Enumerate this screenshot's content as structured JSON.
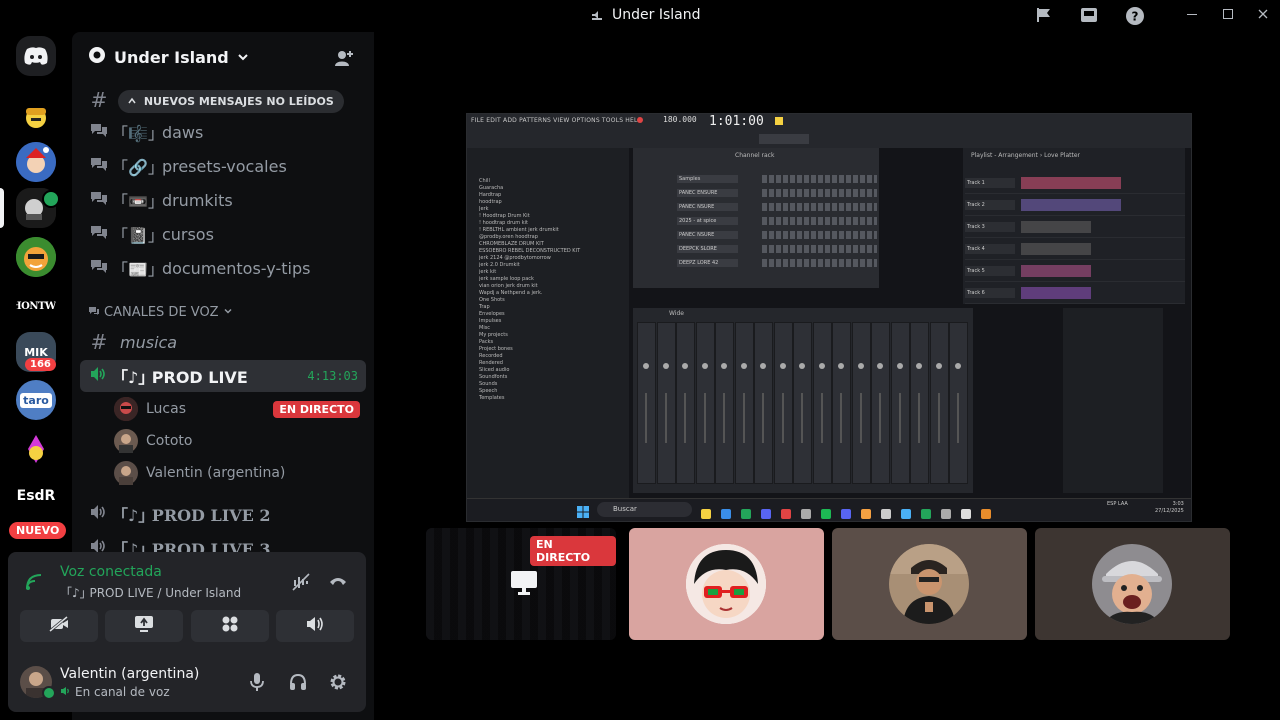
{
  "window": {
    "title": "Under Island"
  },
  "servers": {
    "items": [
      {
        "name": "Discord home",
        "label": ""
      },
      {
        "name": "Server 1",
        "label": ""
      },
      {
        "name": "Server 2",
        "label": ""
      },
      {
        "name": "Server 3",
        "label": ""
      },
      {
        "name": "Server 4",
        "label": ""
      },
      {
        "name": "HONTWI",
        "label": "HONTWI"
      },
      {
        "name": "MIK",
        "label": "MIK",
        "badge": "166"
      },
      {
        "name": "Taro",
        "label": "taro"
      },
      {
        "name": "Server 8",
        "label": ""
      },
      {
        "name": "EsdR",
        "label": "EsdR"
      }
    ],
    "new_badge": "NUEVO"
  },
  "guild": {
    "name": "Under Island"
  },
  "channels": {
    "new_messages": "NUEVOS MENSAJES NO LEÍDOS",
    "text": [
      {
        "icon": "#",
        "emoji": "",
        "name": ""
      },
      {
        "icon": "forum",
        "emoji": "｢🎼｣",
        "name": "daws"
      },
      {
        "icon": "forum",
        "emoji": "｢🔗｣",
        "name": "presets-vocales"
      },
      {
        "icon": "forum",
        "emoji": "｢📼｣",
        "name": "drumkits"
      },
      {
        "icon": "forum",
        "emoji": "｢📓｣",
        "name": "cursos"
      },
      {
        "icon": "forum",
        "emoji": "｢📰｣",
        "name": "documentos-y-tips"
      }
    ],
    "voice_category": "CANALES DE VOZ",
    "musica": "musica",
    "active_voice": {
      "name": "｢♪｣ PROD LIVE",
      "timer": "4:13:03"
    },
    "voice_users": [
      {
        "name": "Lucas",
        "live": "EN DIRECTO"
      },
      {
        "name": "Cototo",
        "live": ""
      },
      {
        "name": "Valentin (argentina)",
        "live": ""
      }
    ],
    "other_voice": [
      "｢♪｣ PROD LIVE 2",
      "｢♪｣ PROD LIVE 3"
    ]
  },
  "voice_panel": {
    "status": "Voz conectada",
    "location": "｢♪｣ PROD LIVE / Under Island",
    "user_name": "Valentin (argentina)",
    "user_status": "En canal de voz"
  },
  "stage": {
    "live_badge": "EN DIRECTO",
    "fl_menu": "FILE EDIT ADD PATTERNS VIEW OPTIONS TOOLS HELP",
    "fl_time": "1:01:00",
    "fl_tempo": "180.000",
    "fl_channel_rack": "Channel rack",
    "fl_playlist": "Playlist - Arrangement › Love Platter",
    "fl_mixer": "Wide",
    "taskbar_search": "Buscar",
    "taskbar_time": "3:03",
    "taskbar_date": "27/12/2025",
    "taskbar_lang": "ESP LAA",
    "browser_items": [
      "Chill",
      "Guaracha",
      "Hardtrap",
      "hoodtrap",
      "Jerk",
      "! Hoodtrap Drum Kit",
      "! hoodtrap drum kit",
      "! REBLTHL ambient jerk drumkit",
      "@prodby.oren hoodtrap",
      "CHROMEBLAZE DRUM KIT",
      "ESSOEBRO REBEL DECONSTRUCTED KIT",
      "jerk 2124 @prodbytomorrow",
      "jerk 2.0 Drumkit",
      "jerk kit",
      "jerk sample loop pack",
      "vian orion jerk drum kit",
      "Wapdj a Nethpend a jerk.",
      "One Shots",
      "Trap",
      "Envelopes",
      "Impulses",
      "Misc",
      "My projects",
      "Packs",
      "Project bones",
      "Recorded",
      "Rendered",
      "Sliced audio",
      "Soundfonts",
      "Sounds",
      "Speech",
      "Templates"
    ],
    "track_labels": [
      "Track 1",
      "Track 2",
      "Track 3",
      "Track 4",
      "Track 5",
      "Track 6"
    ],
    "channel_names": [
      "Samples",
      "PANEC ENSURE",
      "PANEC NSURE",
      "2025 - at spice",
      "PANEC NSURE",
      "DEEPCK SLORE",
      "DEEPZ LORE 42"
    ]
  },
  "colors": {
    "green": "#23a55a",
    "red": "#da373c",
    "tile_pink": "#d9a4a0",
    "tile_brown": "#5b4e48",
    "tile_dark": "#3d3531"
  }
}
